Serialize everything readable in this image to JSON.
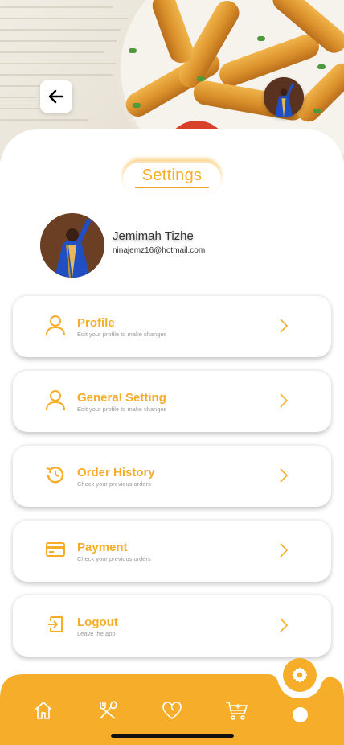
{
  "header": {
    "back_icon": "arrow-left-icon",
    "avatar_icon": "user-avatar-photo"
  },
  "page": {
    "title": "Settings"
  },
  "user": {
    "name": "Jemimah Tizhe",
    "email": "ninajemz16@hotmail.com"
  },
  "menu": [
    {
      "label": "Profile",
      "subtitle": "Edit your profile to make changes",
      "icon": "user-icon"
    },
    {
      "label": "General Setting",
      "subtitle": "Edit your profile to make changes",
      "icon": "user-icon"
    },
    {
      "label": "Order History",
      "subtitle": "Check your previous orders",
      "icon": "history-icon"
    },
    {
      "label": "Payment",
      "subtitle": "Check your previous orders",
      "icon": "credit-card-icon"
    },
    {
      "label": "Logout",
      "subtitle": "Leave the app",
      "icon": "logout-icon"
    }
  ],
  "bottom_nav": {
    "items": [
      "home-icon",
      "utensils-icon",
      "heart-icon",
      "cart-icon",
      "active-dot"
    ],
    "fab_icon": "gear-icon"
  },
  "colors": {
    "accent": "#f6ad29",
    "text": "#333333",
    "subtext": "#9a9a9a",
    "nav_bg": "#f6ad29"
  }
}
